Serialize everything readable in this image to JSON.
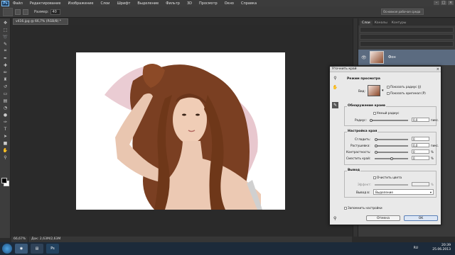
{
  "menubar": {
    "logo": "Ps",
    "items": [
      "Файл",
      "Редактирование",
      "Изображение",
      "Слои",
      "Шрифт",
      "Выделение",
      "Фильтр",
      "3D",
      "Просмотр",
      "Окно",
      "Справка"
    ]
  },
  "options": {
    "size_label": "Размер:",
    "size_value": "40",
    "workspace": "Основная рабочая среда"
  },
  "document": {
    "tab_title": "v416.jpg @ 66,7% (RGB/8) *",
    "zoom": "66,67%",
    "doc_info": "Док: 2,63M/2,63M"
  },
  "panel": {
    "tabs": [
      "Слои",
      "Каналы",
      "Контуры"
    ],
    "layer_name": "Фон"
  },
  "dialog": {
    "title": "Уточнить край",
    "view_mode": {
      "heading": "Режим просмотра",
      "view_label": "Вид:",
      "show_radius": "Показать радиус (J)",
      "show_original": "Показать оригинал (P)"
    },
    "edge_detection": {
      "heading": "Обнаружение краев",
      "smart_radius": "Умный радиус",
      "radius_label": "Радиус:",
      "radius_value": "0,0",
      "radius_unit": "пикс."
    },
    "adjust_edge": {
      "heading": "Настройка края",
      "smooth_label": "Сгладить:",
      "smooth_value": "0",
      "feather_label": "Растушевка:",
      "feather_value": "0,0",
      "feather_unit": "пикс.",
      "contrast_label": "Контрастность:",
      "contrast_value": "0",
      "contrast_unit": "%",
      "shift_label": "Сместить край:",
      "shift_value": "0",
      "shift_unit": "%"
    },
    "output": {
      "heading": "Вывод",
      "decontaminate": "Очистить цвета",
      "amount_label": "Эффект:",
      "output_to_label": "Вывод в:",
      "output_to_value": "Выделение"
    },
    "remember": "Запомнить настройки",
    "cancel": "Отмена",
    "ok": "OK"
  },
  "taskbar": {
    "lang": "RU",
    "time": "20:39",
    "date": "25.06.2013"
  },
  "colors": {
    "ps_blue": "#7fc4ff",
    "ok_button": "#dce6f5"
  },
  "icons": [
    "zoom-icon",
    "hand-icon",
    "brush-icon",
    "close-icon",
    "eye-icon",
    "start-icon",
    "chrome-icon",
    "photoshop-icon"
  ]
}
